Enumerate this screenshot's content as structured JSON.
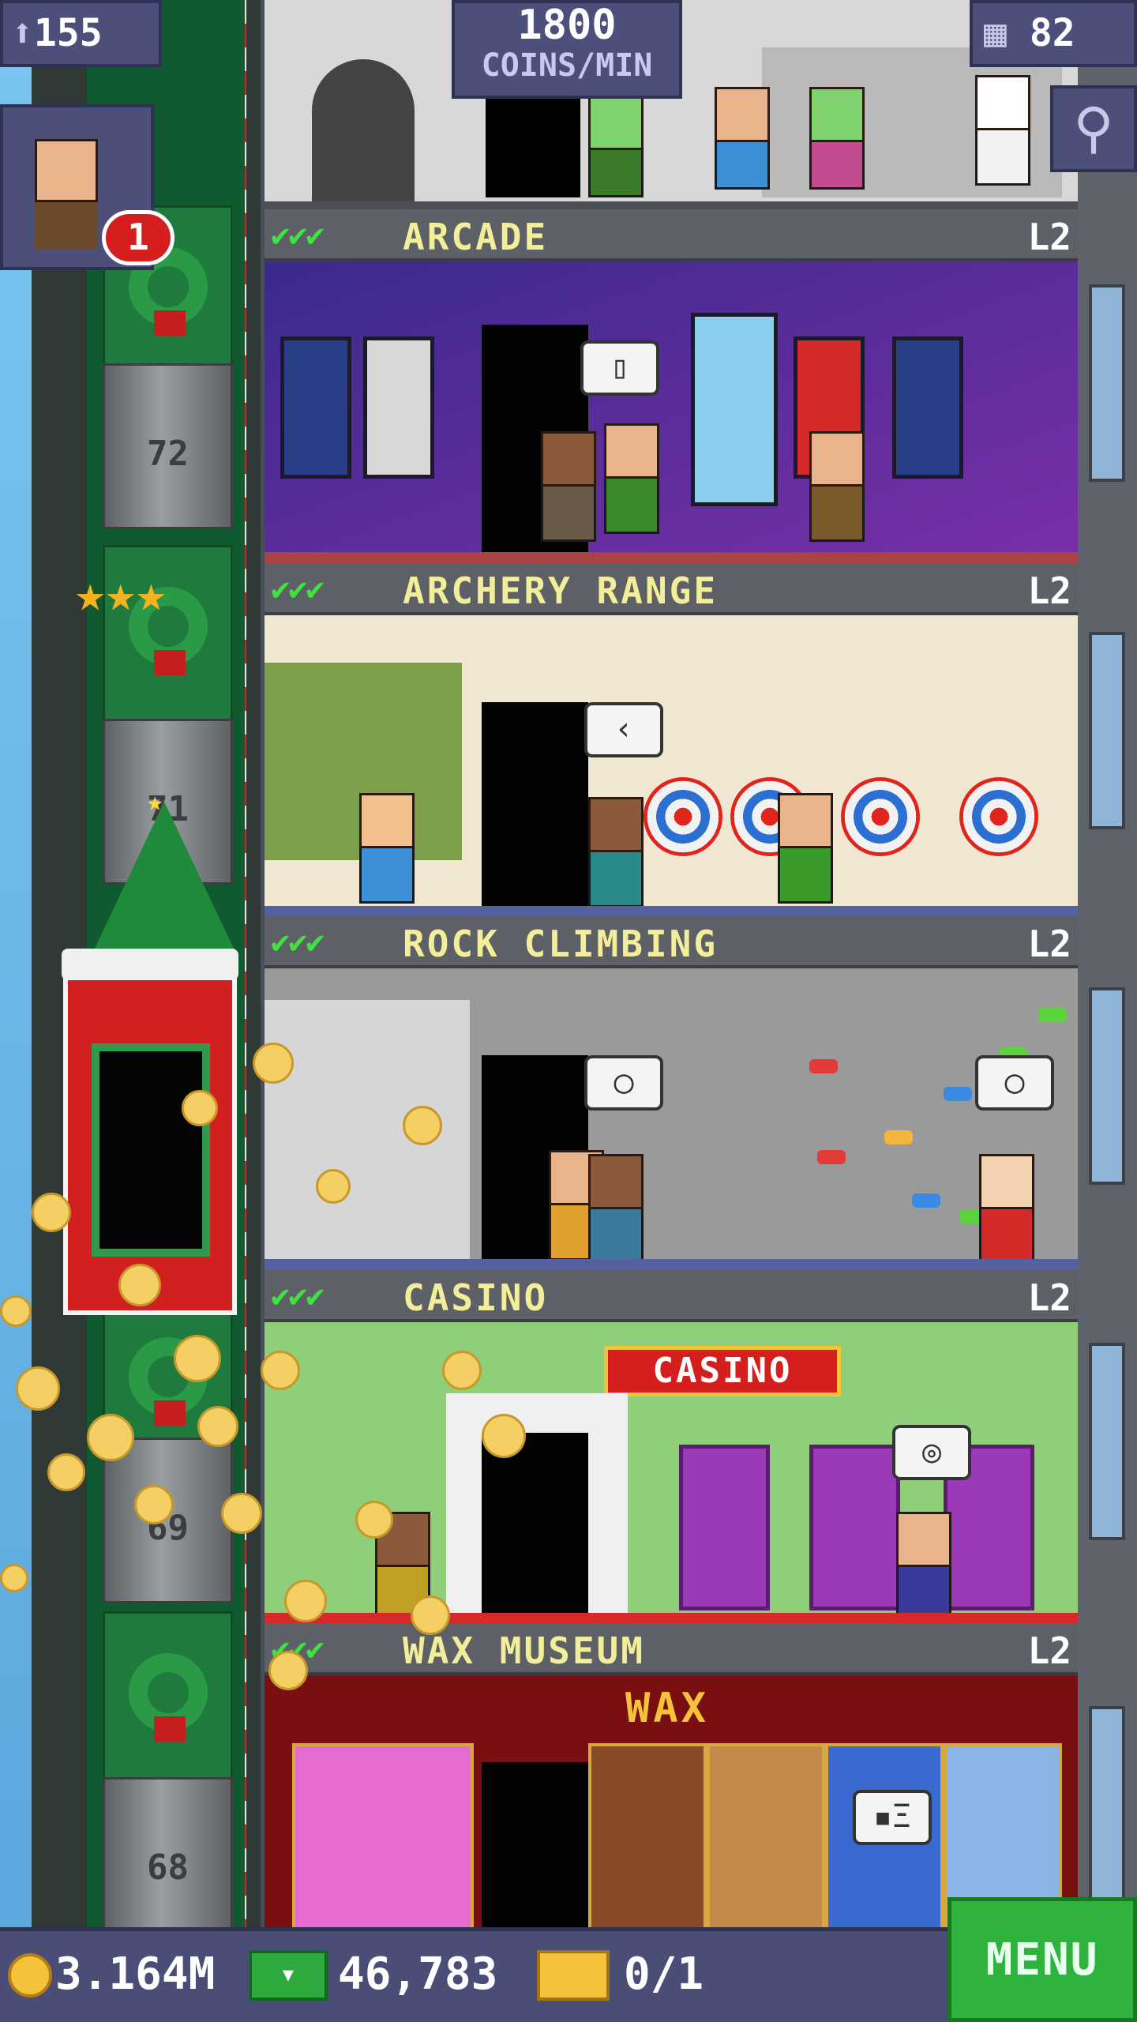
{
  "hud": {
    "population": "155",
    "population_icon": "person-icon",
    "coin_rate_value": "1800",
    "coin_rate_unit": "COINS/MIN",
    "floor_count": "82",
    "floor_icon": "building-icon",
    "search_icon": "magnifier-icon",
    "visitor_badge": "1"
  },
  "elevator": {
    "floor_numbers": [
      "72",
      "71",
      "69",
      "68"
    ]
  },
  "floors": [
    {
      "name": "ARCADE",
      "level": "L2",
      "checks": "✔✔✔",
      "bubble": "▯"
    },
    {
      "name": "ARCHERY RANGE",
      "level": "L2",
      "checks": "✔✔✔",
      "bubble": "‹"
    },
    {
      "name": "ROCK CLIMBING",
      "level": "L2",
      "checks": "✔✔✔",
      "bubble": "◯"
    },
    {
      "name": "CASINO",
      "level": "L2",
      "checks": "✔✔✔",
      "bubble": "◎"
    },
    {
      "name": "WAX MUSEUM",
      "level": "L2",
      "checks": "✔✔✔",
      "bubble": "▪Ξ"
    }
  ],
  "room_signs": {
    "casino": "CASINO",
    "wax": "WAX"
  },
  "bottom_bar": {
    "coins": "3.164M",
    "bux": "46,783",
    "tickets": "0/1",
    "menu_label": "MENU"
  },
  "colors": {
    "hud_panel": "#4c4f7a",
    "floor_name": "#f2ee9a",
    "checks": "#3fe23f",
    "menu_green": "#2fb33e",
    "coin_gold": "#f4c33a"
  }
}
